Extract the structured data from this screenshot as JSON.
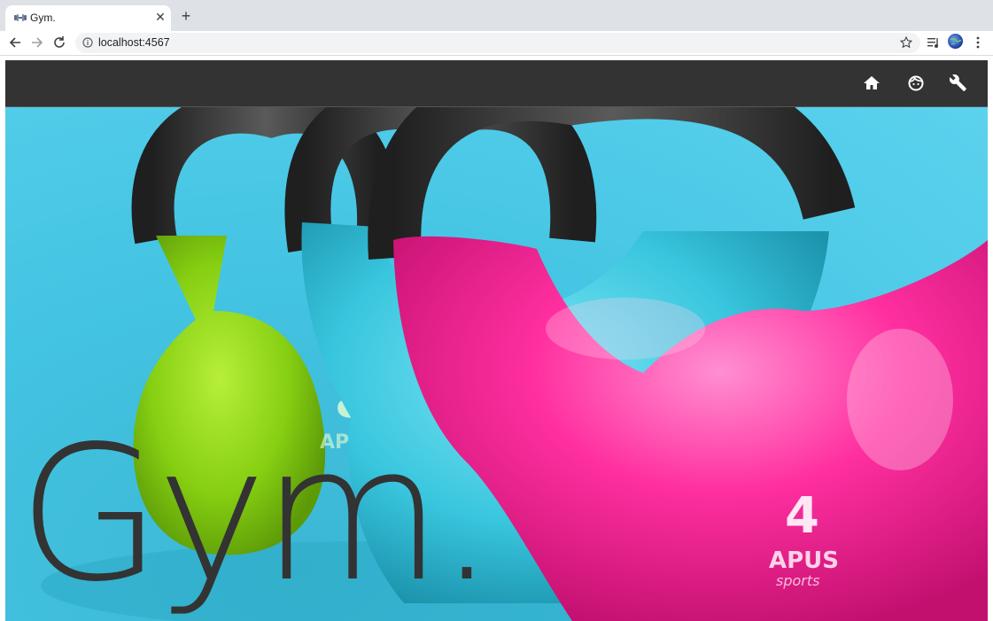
{
  "browser": {
    "tab_title": "Gym.",
    "tab_close": "✕",
    "new_tab": "+",
    "url": "localhost:4567"
  },
  "nav": {
    "icons": [
      "home-icon",
      "face-icon",
      "wrench-icon"
    ],
    "background": "#333333"
  },
  "hero": {
    "title": "Gym.",
    "kettlebell_labels": [
      {
        "number": "8",
        "brand": "APUS"
      },
      {
        "number": "4",
        "brand": "APUS",
        "sub": "sports"
      }
    ],
    "colors": {
      "sky": "#4fc7e6",
      "lime": "#8fd60f",
      "cyan": "#3fd0e8",
      "magenta": "#ff2fa0",
      "handle": "#2b2b2b"
    }
  }
}
